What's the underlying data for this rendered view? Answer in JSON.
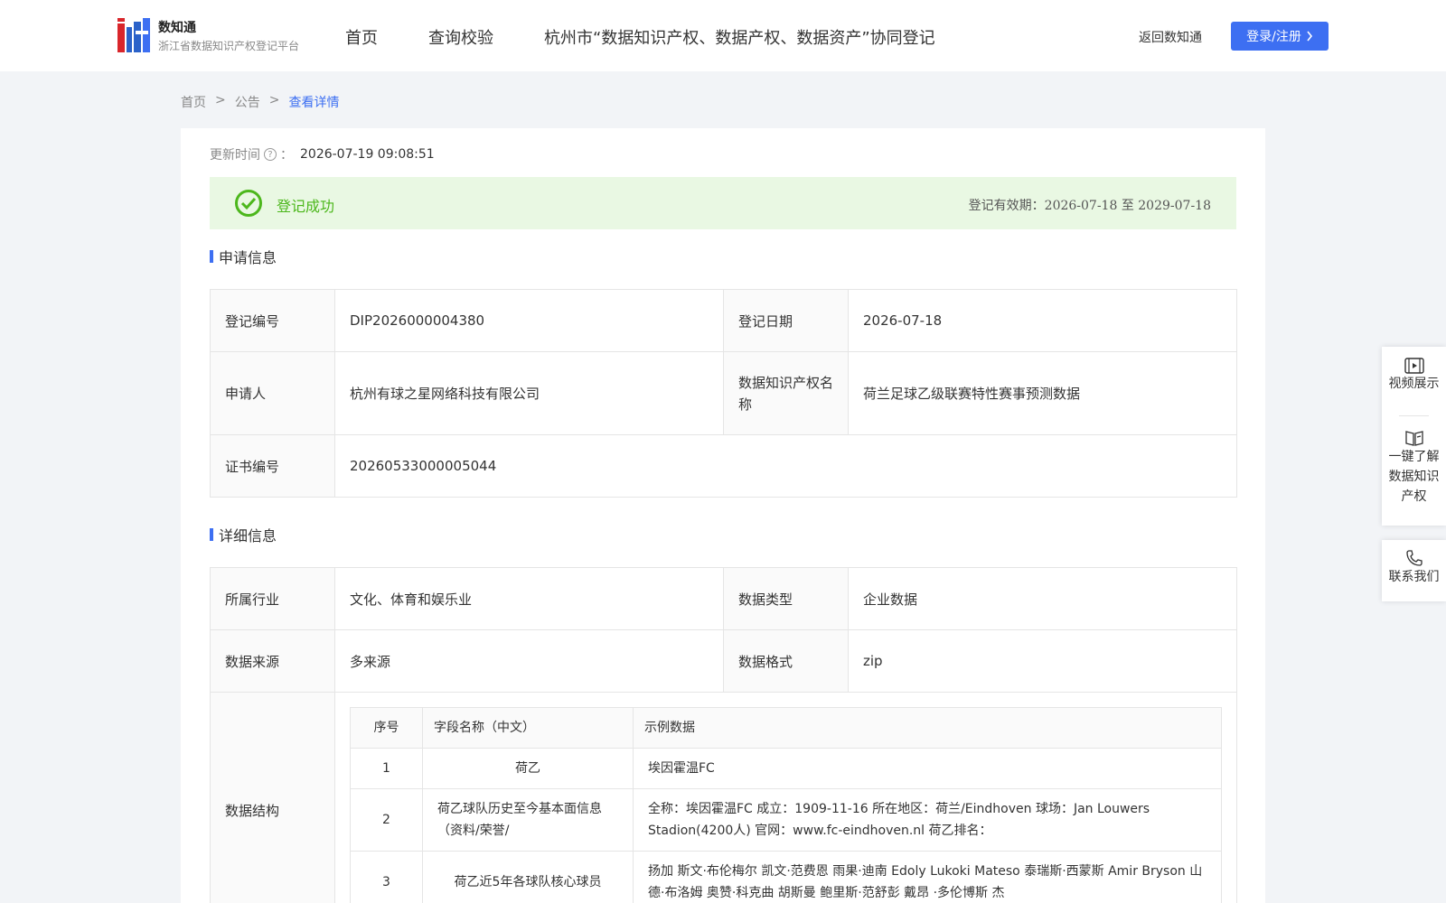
{
  "header": {
    "brand_name": "数知通",
    "brand_sub": "浙江省数据知识产权登记平台",
    "nav": [
      "首页",
      "查询校验",
      "杭州市“数据知识产权、数据产权、数据资产”协同登记"
    ],
    "back_link": "返回数知通",
    "login_label": "登录/注册"
  },
  "breadcrumb": {
    "items": [
      "首页",
      "公告",
      "查看详情"
    ],
    "separator": ">"
  },
  "update": {
    "label": "更新时间",
    "colon": "：",
    "value": "2026-07-19 09:08:51"
  },
  "status": {
    "text": "登记成功",
    "validity": "登记有效期：2026-07-18 至 2029-07-18"
  },
  "application": {
    "title": "申请信息",
    "rows": [
      {
        "l1": "登记编号",
        "v1": "DIP2026000004380",
        "l2": "登记日期",
        "v2": "2026-07-18"
      },
      {
        "l1": "申请人",
        "v1": "杭州有球之星网络科技有限公司",
        "l2": "数据知识产权名称",
        "v2": "荷兰足球乙级联赛特性赛事预测数据"
      },
      {
        "l1": "证书编号",
        "v1": "20260533000005044"
      }
    ]
  },
  "detail": {
    "title": "详细信息",
    "rows": [
      {
        "l1": "所属行业",
        "v1": "文化、体育和娱乐业",
        "l2": "数据类型",
        "v2": "企业数据"
      },
      {
        "l1": "数据来源",
        "v1": "多来源",
        "l2": "数据格式",
        "v2": "zip"
      }
    ],
    "structure_label": "数据结构",
    "structure": {
      "headers": [
        "序号",
        "字段名称（中文）",
        "示例数据"
      ],
      "rows": [
        {
          "no": "1",
          "name": "荷乙",
          "example": "埃因霍温FC"
        },
        {
          "no": "2",
          "name": "荷乙球队历史至今基本面信息（资料/荣誉/",
          "example": "全称：埃因霍温FC 成立：1909-11-16 所在地区：荷兰/Eindhoven 球场：Jan Louwers Stadion(4200人) 官网：www.fc-eindhoven.nl 荷乙排名："
        },
        {
          "no": "3",
          "name": "荷乙近5年各球队核心球员",
          "example": "扬加 斯文·布伦梅尔 凯文·范费恩 雨果·迪南 Edoly Lukoki Mateso 泰瑞斯·西蒙斯 Amir Bryson 山德·布洛姆 奥赞·科克曲 胡斯曼 鲍里斯·范舒彭 戴昂 ·多伦博斯 杰"
        }
      ]
    }
  },
  "side_panel": {
    "video": "视频展示",
    "learn": "一键了解数据知识产权",
    "contact": "联系我们"
  },
  "colors": {
    "accent": "#3d6ff2",
    "success": "#4cb71c",
    "success_bg": "#e9f8e3"
  }
}
